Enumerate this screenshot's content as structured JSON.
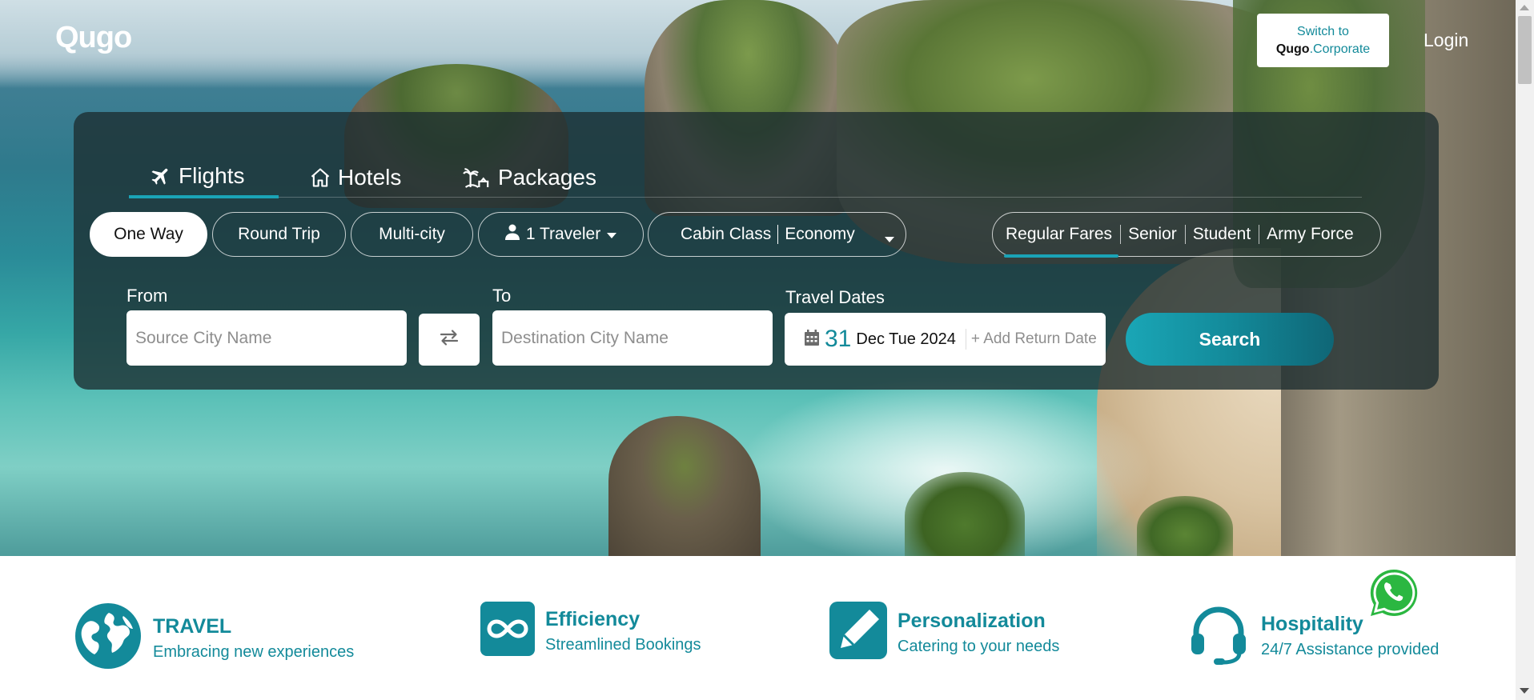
{
  "header": {
    "logo": "Qugo",
    "switch_line1": "Switch to",
    "switch_brand": "Qugo",
    "switch_suffix": ".Corporate",
    "login": "Login"
  },
  "tabs": [
    {
      "label": "Flights",
      "icon": "plane-icon",
      "active": true
    },
    {
      "label": "Hotels",
      "icon": "house-icon",
      "active": false
    },
    {
      "label": "Packages",
      "icon": "palm-tree-icon",
      "active": false
    }
  ],
  "trip_types": [
    {
      "label": "One Way",
      "active": true
    },
    {
      "label": "Round Trip",
      "active": false
    },
    {
      "label": "Multi-city",
      "active": false
    }
  ],
  "travelers": {
    "label": "1 Traveler",
    "icon": "person-icon"
  },
  "cabin": {
    "label": "Cabin Class",
    "value": "Economy"
  },
  "fares": [
    {
      "label": "Regular Fares",
      "active": true
    },
    {
      "label": "Senior",
      "active": false
    },
    {
      "label": "Student",
      "active": false
    },
    {
      "label": "Army Force",
      "active": false
    }
  ],
  "form": {
    "from_label": "From",
    "from_placeholder": "Source City Name",
    "to_label": "To",
    "to_placeholder": "Destination City Name",
    "dates_label": "Travel Dates",
    "date_day": "31",
    "date_rest": "Dec Tue 2024",
    "return_label": "+ Add Return Date",
    "search_label": "Search"
  },
  "features": [
    {
      "title": "TRAVEL",
      "subtitle": "Embracing new experiences",
      "icon": "globe-icon"
    },
    {
      "title": "Efficiency",
      "subtitle": "Streamlined Bookings",
      "icon": "infinity-icon"
    },
    {
      "title": "Personalization",
      "subtitle": "Catering to your needs",
      "icon": "pen-icon"
    },
    {
      "title": "Hospitality",
      "subtitle": "24/7 Assistance provided",
      "icon": "headset-icon"
    }
  ],
  "colors": {
    "accent": "#138a9a",
    "panel": "#1c2d30",
    "tab_underline": "#1aa3b6"
  }
}
